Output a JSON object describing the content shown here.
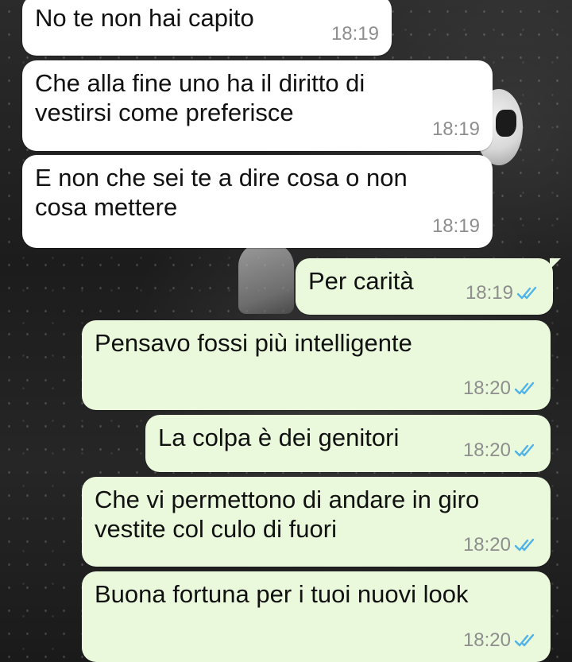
{
  "colors": {
    "incoming_bubble": "#ffffff",
    "outgoing_bubble": "#eaf9dc",
    "timestamp": "#8e8e8e",
    "read_ticks": "#4fb3e8"
  },
  "messages": [
    {
      "direction": "incoming",
      "text": "No te non hai capito",
      "time": "18:19"
    },
    {
      "direction": "incoming",
      "text": "Che alla fine uno ha il diritto di\nvestirsi come preferisce",
      "time": "18:19"
    },
    {
      "direction": "incoming",
      "text": "E non che sei te a dire cosa o non\ncosa mettere",
      "time": "18:19"
    },
    {
      "direction": "outgoing",
      "text": "Per carità",
      "time": "18:19",
      "status": "read"
    },
    {
      "direction": "outgoing",
      "text": "Pensavo fossi più intelligente",
      "time": "18:20",
      "status": "read"
    },
    {
      "direction": "outgoing",
      "text": "La colpa è dei genitori",
      "time": "18:20",
      "status": "read"
    },
    {
      "direction": "outgoing",
      "text": "Che vi permettono di andare in giro\nvestite col culo di fuori",
      "time": "18:20",
      "status": "read"
    },
    {
      "direction": "outgoing",
      "text": "Buona fortuna per i tuoi nuovi look",
      "time": "18:20",
      "status": "read"
    }
  ],
  "icons": {
    "read_status": "double-check-icon"
  }
}
